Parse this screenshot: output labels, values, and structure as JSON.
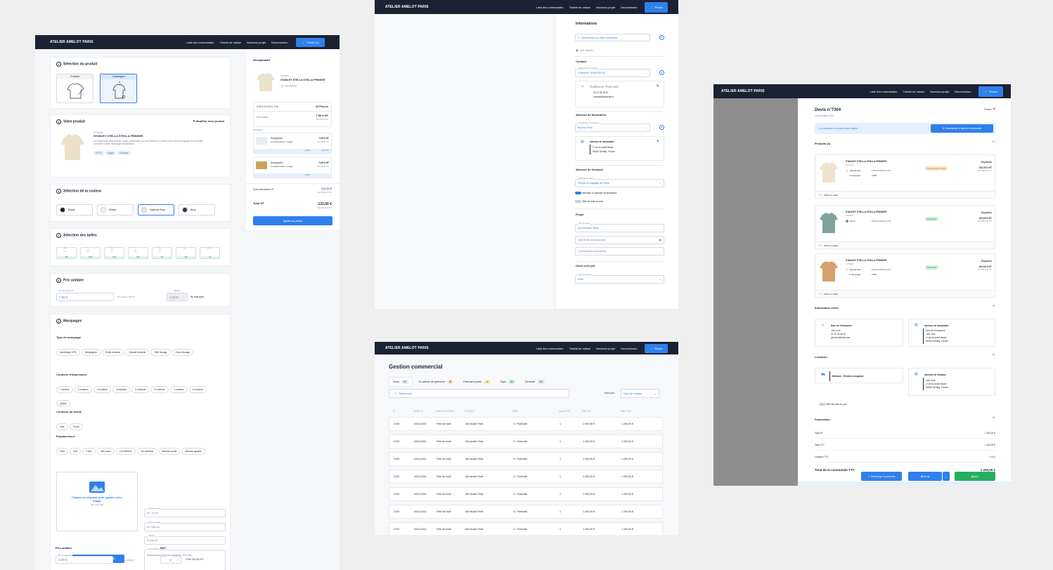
{
  "nav": {
    "brand": "ATELIER AMELOT PARIS",
    "links": [
      "Liste des commandes",
      "Tickets de caisse",
      "Nouveau projet",
      "Deconnexion"
    ],
    "cart_label": "Panier (1)",
    "cart_label_short": "Panier"
  },
  "config": {
    "step1": {
      "title": "Sélection du produit",
      "options": [
        "Custom",
        "Catalogue"
      ]
    },
    "step2": {
      "title": "Votre produit",
      "edit": "Modifier mon produit",
      "ref": "STTU034",
      "name": "STANLEY STELLA STELLA FRINGER",
      "desc": "Le t-shirt épais boxy femme Coupe confortable Col droit Manches courtes 100% coton biologique filé et peigné Comment à faire, technique d'impression",
      "tags": [
        "GOTS",
        "Vegan",
        "Fairwear"
      ]
    },
    "step3": {
      "title": "Sélection de la couleur",
      "colors": [
        {
          "name": "Black",
          "hex": "#1b1b1b"
        },
        {
          "name": "White",
          "hex": "#f4f4f4"
        },
        {
          "name": "Natural Raw",
          "hex": "#f3e3c8"
        },
        {
          "name": "Blue",
          "hex": "#2d3648"
        }
      ]
    },
    "step4": {
      "title": "Sélection des tailles",
      "sizes": [
        {
          "label": "XS",
          "qty": "1",
          "stock": "430"
        },
        {
          "label": "S",
          "qty": "2",
          "stock": "1200"
        },
        {
          "label": "M",
          "qty": "2",
          "stock": "1341"
        },
        {
          "label": "L",
          "qty": "2",
          "stock": "800"
        },
        {
          "label": "XL",
          "qty": "1",
          "stock": "716"
        },
        {
          "label": "XXL",
          "qty": "",
          "stock": "365"
        },
        {
          "label": "XXXL",
          "qty": "",
          "stock": "34"
        }
      ]
    },
    "step5": {
      "title": "Prix unitaire",
      "price_label": "Prix au apport HT",
      "price": "7,90 €",
      "price_hint": "Prix défaut 7,80€ HT",
      "margin_label": "Marge",
      "margin": "2,20 €",
      "margin_pct": "%",
      "margin_suffix": "marquer"
    },
    "step6": {
      "title": "Marquages",
      "type_title": "Type de marquage",
      "types": [
        "Numérique DTG",
        "Sérigraphie",
        "Petite broderie",
        "Grande broderie",
        "Petit flocage",
        "Grand flocage"
      ],
      "colors_title": "Couleurs d'impression",
      "colors": [
        "1 couleur",
        "2 couleurs",
        "3 couleurs",
        "4 couleurs",
        "5 couleurs",
        "6 couleurs",
        "7 couleurs",
        "8 couleurs",
        "Quadri"
      ],
      "textile_title": "Couleurs du textile",
      "textile": [
        "Clair",
        "Foncé"
      ],
      "place_title": "Emplacement",
      "places": [
        "Face",
        "Dos",
        "Coeur",
        "Anti coeur",
        "Col intérieur",
        "Col extérieur",
        "Manche droite",
        "Manche gauche"
      ],
      "upload_text": "Cliquez ou déposer pour ajouter votre image",
      "upload_hint": "JPG, PNG, PDF",
      "upload_button": "Placer une image sur un produit",
      "field1_label": "Distance du col",
      "field1_ph": "Ex. 10 cm",
      "field2_label": "Taille de l'image",
      "field2_ph": "Ex. 8x8 cm",
      "field3_label": "Calques",
      "field3_ph": "Fichier AI",
      "field4_label": "Commentaire",
      "field4_ph": "Informations complémentaires, mot clés...",
      "price_title": "Prix unitaire",
      "price_label": "Prix au apport HT",
      "price": "3,90 €",
      "price_hint": "Prix défaut 3,80€ HT",
      "bat_title": "BAT",
      "bat_qty_label": "Quantité",
      "bat_qty": "2",
      "bat_price": "Prix 15,00 HT"
    }
  },
  "recap": {
    "title": "Récapitulatif",
    "ref": "STTU034",
    "name": "STANLEY STELLA STELLA FRINGER",
    "color": "Natural Raw",
    "sizes": "2 XS  4 S  4 M  4 L  2 XL",
    "pieces": "16 Pièces",
    "unit_label": "Prix unitaire",
    "unit_price": "7,90 € HT",
    "unit_price_sub": "Soit 8,90 € TTC",
    "markings_title": "Marquages",
    "markings": [
      {
        "name": "Sérigraphie",
        "detail": "2 couleurs Face, 1 image",
        "price": "7,90 € HT",
        "sub": "Soit 8,90 € TTC",
        "bat": "1 BAT",
        "bat_price": "100 TTC"
      },
      {
        "name": "Sérigraphie",
        "detail": "2 couleurs Face, 1 image",
        "price": "7,90 € HT",
        "sub": "Soit 8,90 € TTC",
        "bat": "0 BAT",
        "bat_price": ""
      }
    ],
    "subtotal_label": "Sous-total pièces HT",
    "subtotal": "132,00 €",
    "subtotal_sub": "Soit 158,40 € TTC",
    "total_label": "Total HT",
    "total": "132,00 €",
    "total_sub": "Soit 158,40 € TTC",
    "add_button": "Ajouter au panier"
  },
  "info": {
    "title": "Informations",
    "search_ph": "Rechercher un client, entreprise",
    "company": "AW Studio",
    "contact_title": "Contact",
    "contact_label": "Sélectionnez un contact",
    "contact_value": "Guillaume THIERCELIN",
    "contact_name": "Guillaume Thiercelin",
    "contact_phone": "01 23 34 45 67",
    "contact_email": "contact@awstudio.fr",
    "billing_title": "Adresse de facturation",
    "billing_label": "Sélectionnez une adresse",
    "billing_value": "Bureau Paris",
    "billing_card_title": "Adresse de facturation",
    "billing_line1": "2 rue du soleil levant",
    "billing_line2": "94250 Gentilly, France",
    "delivery_title": "Adresse de livraison",
    "delivery_label": "Méthode de retrait",
    "delivery_value": "Retrait au magasin de Paris",
    "toggle1": "Identique à l'adresse de facturation",
    "toggle2": "Offrir les frais de port",
    "project_title": "Projet",
    "project_label": "Nom du projet",
    "project_value": "Anniversaire Team",
    "date_ph": "Date limite de production",
    "comment_ph": "Commentaire commande",
    "creator_title": "Devis créé par",
    "creator_label": "Nom du vendeur",
    "creator_value": "Elise"
  },
  "gestion": {
    "title": "Gestion commercial",
    "tabs": [
      {
        "label": "Devis",
        "count": "12",
        "color": "#d6e6fb"
      },
      {
        "label": "En attente de paiement",
        "count": "45",
        "color": "#fde2c4"
      },
      {
        "label": "Paiement partiel",
        "count": "12",
        "color": "#fdf0b8"
      },
      {
        "label": "Payé",
        "count": "34",
        "color": "#c9f0d5"
      },
      {
        "label": "Terminés",
        "count": "112",
        "color": "#e5e7eb"
      }
    ],
    "search_ph": "Rechercher",
    "sort_label": "Trier par",
    "sort_value": "Date de création",
    "columns": [
      "N°",
      "CRÉÉ LE",
      "NOM DU PROJET",
      "SOCIÉTÉ",
      "NOM",
      "QUANTITÉ",
      "PRIX HT",
      "PRIX TTC"
    ],
    "rows": [
      [
        "2193",
        "04/11/2021",
        "Fête de Noël",
        "AW studio Paris",
        "G. Thiercelin",
        "1",
        "1 000,00 €",
        "1 200,00 €"
      ],
      [
        "2193",
        "04/11/2021",
        "Fête de Noël",
        "AW studio Paris",
        "G. Thiercelin",
        "1",
        "1 000,00 €",
        "1 200,00 €"
      ],
      [
        "2193",
        "04/11/2021",
        "Fête de Noël",
        "AW studio Paris",
        "G. Thiercelin",
        "1",
        "1 000,00 €",
        "1 200,00 €"
      ],
      [
        "2193",
        "04/11/2021",
        "Fête de Noël",
        "AW studio Paris",
        "G. Thiercelin",
        "1",
        "1 000,00 €",
        "1 200,00 €"
      ],
      [
        "2193",
        "04/11/2021",
        "Fête de Noël",
        "AW studio Paris",
        "G. Thiercelin",
        "1",
        "1 000,00 €",
        "1 200,00 €"
      ],
      [
        "2193",
        "04/11/2021",
        "Fête de Noël",
        "AW studio Paris",
        "G. Thiercelin",
        "1",
        "1 000,00 €",
        "1 200,00 €"
      ],
      [
        "2193",
        "04/11/2021",
        "Fête de Noël",
        "AW studio Paris",
        "G. Thiercelin",
        "1",
        "1 000,00 €",
        "1 200,00 €"
      ]
    ]
  },
  "devis": {
    "title": "Devis n°7304",
    "date": "15 Décembre 2021",
    "close": "Fermer",
    "notice": "La commande n'est pas encore validée",
    "transform": "Transformer le devis en commande",
    "products_title": "Produits (3)",
    "products": [
      {
        "name": "STANLEY STELLA STELLA FRINGER",
        "ref": "STTU034",
        "color": "Natural Raw",
        "color_hex": "#f3e3c8",
        "sizes": "2 XS  4 S  4 M  4 L  2 XL",
        "marks": "2 marquages",
        "bat": "2 BAT",
        "status": "Commandé le 12 fév.",
        "status_bg": "#fde2c4",
        "status_fg": "#c26a12",
        "pieces": "16 pièces",
        "price": "132,00 € HT",
        "sub": "Soit 158,40 € TTC",
        "toggle": "Afficher le détail",
        "shirt": "#efe3cf"
      },
      {
        "name": "STANLEY STELLA STELLA FRINGER",
        "ref": "STTU034",
        "color": "Green",
        "color_hex": "#6f958f",
        "sizes": "2 XS  4 S  4 M  4 L  2 XL",
        "marks": "",
        "bat": "",
        "status": "Disponible",
        "status_bg": "#cdeed8",
        "status_fg": "#1e8c4a",
        "pieces": "16 pièces",
        "price": "132,00 € HT",
        "sub": "Soit 158,40 € TTC",
        "toggle": "Afficher le détail",
        "shirt": "#7fa39c"
      },
      {
        "name": "STANLEY STELLA STELLA FRINGER",
        "ref": "STTU034",
        "color": "Natural Raw",
        "color_hex": "#f3e3c8",
        "sizes": "2 XS  4 S  4 M  4 L  2 XL",
        "marks": "2 marquages",
        "bat": "2 BAT",
        "status": "Disponible",
        "status_bg": "#cdeed8",
        "status_fg": "#1e8c4a",
        "pieces": "16 pièces",
        "price": "132,00 € HT",
        "sub": "Soit 158,40 € TTC",
        "toggle": "Afficher le détail",
        "shirt": "#d7a06c"
      }
    ],
    "client_title": "Information client",
    "company_card_title": "Nom de l'entreprise",
    "company_lines": [
      "John Doe",
      "01 23 34 45 67",
      "johndoe@mail.com"
    ],
    "address_card_title": "Adresse de facturation",
    "address_lines": [
      "Nom de l'entreprise",
      "John Doe",
      "2 rue du soleil levant",
      "94250 Gentilly, France"
    ],
    "delivery_title": "Livraison",
    "method": "Méthode : Retrait en magasin",
    "free_shipping": "Offrir les frais de port",
    "delivery_card_title": "Adresse de livraison",
    "delivery_lines": [
      "John Doe",
      "2 rue du soleil levant",
      "94250 Gentilly, France"
    ],
    "billing_title": "Facturation",
    "lines": [
      {
        "label": "Total HT",
        "value": "1 000,00 €"
      },
      {
        "label": "Total TTC",
        "value": "1 200,00 €"
      },
      {
        "label": "Livraison TTC",
        "value": "Gratuit"
      }
    ],
    "grand_label": "Total de la commande TTC",
    "grand_value": "1 200,00 €",
    "btn_download": "Télécharger la proforma",
    "btn_devis": "Devis",
    "btn_bat": "BAT"
  }
}
